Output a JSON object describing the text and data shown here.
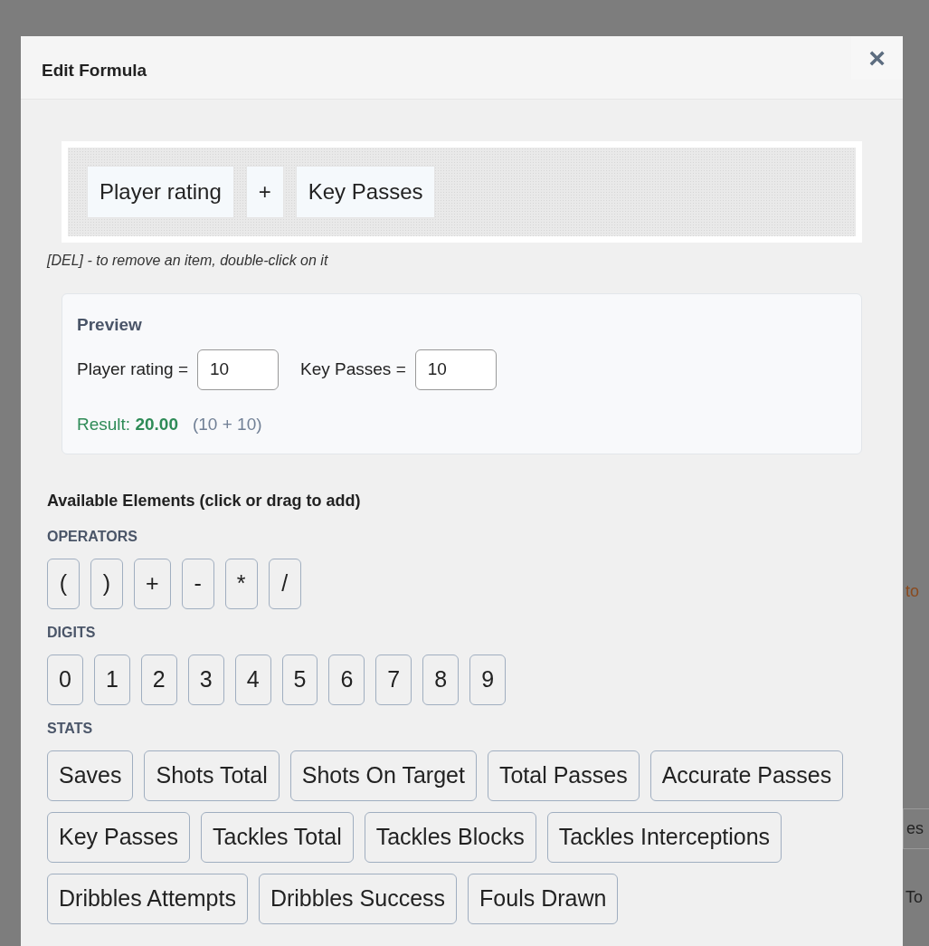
{
  "modal": {
    "title": "Edit Formula",
    "close": "×"
  },
  "formula": {
    "items": [
      {
        "label": "Player rating"
      },
      {
        "label": "+"
      },
      {
        "label": "Key Passes"
      }
    ],
    "hint": "[DEL] - to remove an item, double-click on it"
  },
  "preview": {
    "title": "Preview",
    "inputs": [
      {
        "label": "Player rating =",
        "value": "10"
      },
      {
        "label": "Key Passes =",
        "value": "10"
      }
    ],
    "result_label": "Result:",
    "result_value": "20.00",
    "expression": "(10 + 10)"
  },
  "elements": {
    "title": "Available Elements (click or drag to add)",
    "groups": [
      {
        "label": "OPERATORS",
        "items": [
          "(",
          ")",
          "+",
          "-",
          "*",
          "/"
        ]
      },
      {
        "label": "DIGITS",
        "items": [
          "0",
          "1",
          "2",
          "3",
          "4",
          "5",
          "6",
          "7",
          "8",
          "9"
        ]
      },
      {
        "label": "STATS",
        "items": [
          "Saves",
          "Shots Total",
          "Shots On Target",
          "Total Passes",
          "Accurate Passes",
          "Key Passes",
          "Tackles Total",
          "Tackles Blocks",
          "Tackles Interceptions",
          "Dribbles Attempts",
          "Dribbles Success",
          "Fouls Drawn"
        ]
      }
    ]
  },
  "background": {
    "fragments": [
      {
        "text": "to",
        "kind": "link"
      },
      {
        "text": "es",
        "kind": "button"
      },
      {
        "text": "To",
        "kind": "plain"
      }
    ]
  }
}
